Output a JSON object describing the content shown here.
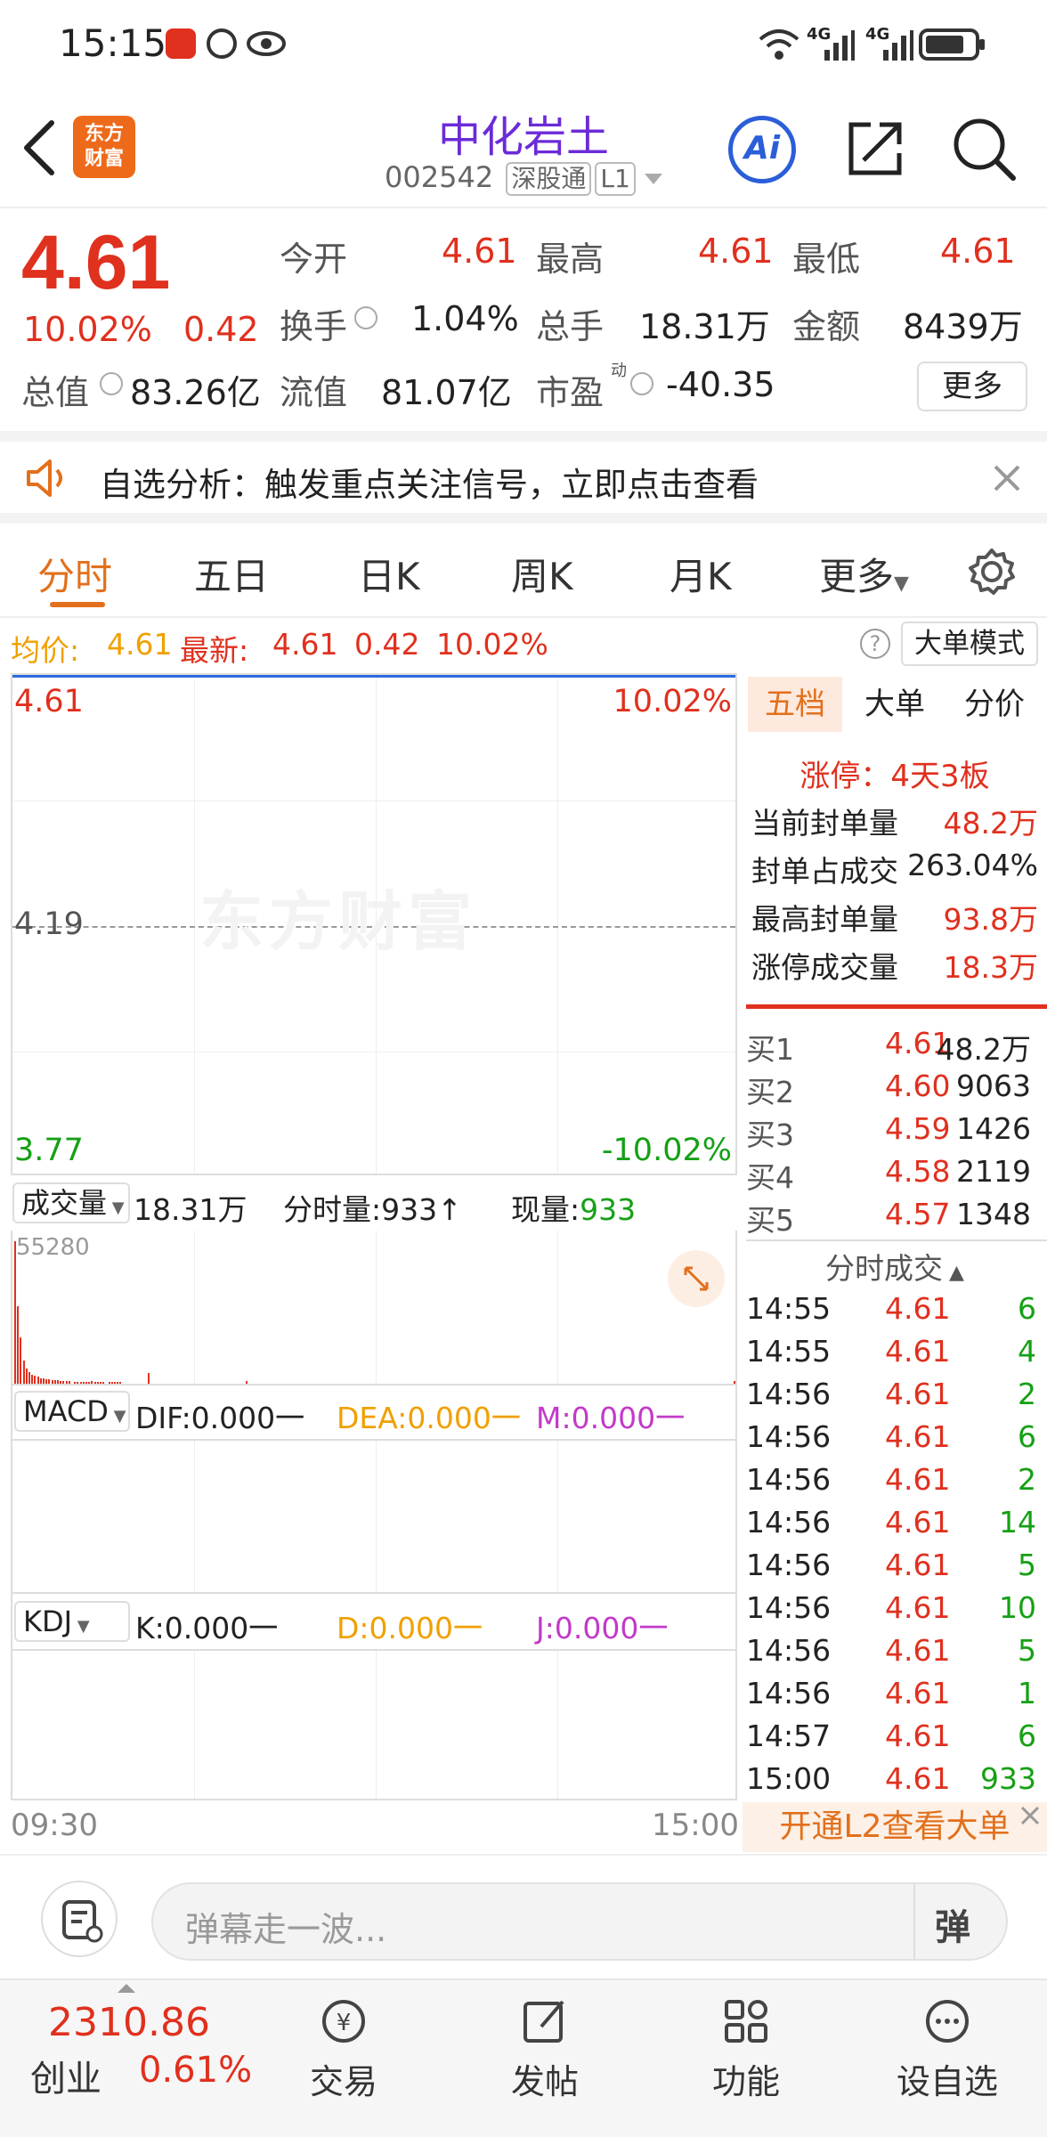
{
  "status_bar": {
    "time": "15:15",
    "signal1": "4G",
    "signal2": "4G"
  },
  "header": {
    "brand_line1": "东方",
    "brand_line2": "财富",
    "stock_name": "中化岩土",
    "stock_code": "002542",
    "market_tag": "深股通",
    "level_tag": "L1",
    "ai_label": "Ai"
  },
  "quote": {
    "price": "4.61",
    "change_pct": "10.02%",
    "change": "0.42",
    "open_label": "今开",
    "open": "4.61",
    "high_label": "最高",
    "high": "4.61",
    "low_label": "最低",
    "low": "4.61",
    "turnover_label": "换手",
    "turnover": "1.04%",
    "volume_label": "总手",
    "volume": "18.31万",
    "amount_label": "金额",
    "amount": "8439万",
    "mcap_label": "总值",
    "mcap": "83.26亿",
    "float_label": "流值",
    "float_cap": "81.07亿",
    "pe_label": "市盈",
    "pe_sup": "动",
    "pe": "-40.35",
    "more_button": "更多"
  },
  "alert": {
    "text": "自选分析：触发重点关注信号，立即点击查看"
  },
  "tabs": [
    "分时",
    "五日",
    "日K",
    "周K",
    "月K",
    "更多"
  ],
  "info_line": {
    "avg_label": "均价:",
    "avg": "4.61",
    "latest_label": "最新:",
    "latest": "4.61",
    "change": "0.42",
    "change_pct": "10.02%",
    "mode_button": "大单模式"
  },
  "chart_data": {
    "type": "line",
    "title": "",
    "y_top": "4.61",
    "y_mid": "4.19",
    "y_bottom": "3.77",
    "pct_top": "10.02%",
    "pct_bottom": "-10.02%",
    "watermark": "东方财富",
    "x_start": "09:30",
    "x_end": "15:00",
    "price_line": [
      4.61,
      4.61
    ],
    "volume_peak_label": "55280",
    "volume_bars": [
      55280,
      30000,
      18000,
      9000,
      6000,
      4500,
      3500,
      3000,
      2600,
      2200,
      2000,
      1800,
      1600,
      1500,
      1400,
      1300,
      1200,
      1100,
      1000,
      900,
      4000,
      800,
      700,
      600,
      600,
      500,
      500,
      900,
      500,
      400,
      400,
      400,
      1200,
      400,
      300,
      300,
      300,
      300,
      933
    ]
  },
  "volume_panel": {
    "selector": "成交量",
    "total": "18.31万",
    "minute_label": "分时量:",
    "minute_value": "933↑",
    "current_label": "现量:",
    "current_value": "933"
  },
  "macd_panel": {
    "selector": "MACD",
    "dif": "DIF:0.000一",
    "dea": "DEA:0.000一",
    "m": "M:0.000一"
  },
  "kdj_panel": {
    "selector": "KDJ",
    "k": "K:0.000一",
    "d": "D:0.000一",
    "j": "J:0.000一"
  },
  "right_panel": {
    "tabs": [
      "五档",
      "大单",
      "分价"
    ],
    "limit_label": "涨停：4天3板",
    "stats": [
      {
        "label": "当前封单量",
        "value": "48.2万"
      },
      {
        "label": "封单占成交",
        "value": "263.04%"
      },
      {
        "label": "最高封单量",
        "value": "93.8万"
      },
      {
        "label": "涨停成交量",
        "value": "18.3万"
      }
    ],
    "bids": [
      {
        "label": "买1",
        "price": "4.61",
        "volume": "48.2万"
      },
      {
        "label": "买2",
        "price": "4.60",
        "volume": "9063"
      },
      {
        "label": "买3",
        "price": "4.59",
        "volume": "1426"
      },
      {
        "label": "买4",
        "price": "4.58",
        "volume": "2119"
      },
      {
        "label": "买5",
        "price": "4.57",
        "volume": "1348"
      }
    ],
    "ticks_title": "分时成交",
    "ticks": [
      {
        "time": "14:55",
        "price": "4.61",
        "vol": "6"
      },
      {
        "time": "14:55",
        "price": "4.61",
        "vol": "4"
      },
      {
        "time": "14:56",
        "price": "4.61",
        "vol": "2"
      },
      {
        "time": "14:56",
        "price": "4.61",
        "vol": "6"
      },
      {
        "time": "14:56",
        "price": "4.61",
        "vol": "2"
      },
      {
        "time": "14:56",
        "price": "4.61",
        "vol": "14"
      },
      {
        "time": "14:56",
        "price": "4.61",
        "vol": "5"
      },
      {
        "time": "14:56",
        "price": "4.61",
        "vol": "10"
      },
      {
        "time": "14:56",
        "price": "4.61",
        "vol": "5"
      },
      {
        "time": "14:56",
        "price": "4.61",
        "vol": "1"
      },
      {
        "time": "14:57",
        "price": "4.61",
        "vol": "6"
      },
      {
        "time": "15:00",
        "price": "4.61",
        "vol": "933"
      }
    ],
    "l2_promo": "开通L2查看大单"
  },
  "danmaku": {
    "placeholder": "弹幕走一波...",
    "button": "弹"
  },
  "bottom_nav": {
    "index_value": "2310.86",
    "index_name": "创业",
    "index_pct": "0.61%",
    "items": [
      "交易",
      "发帖",
      "功能",
      "设自选"
    ]
  },
  "colors": {
    "up": "#e0301e",
    "down": "#15a015",
    "accent": "#e2701c",
    "avg": "#f0a000",
    "title": "#6b2bd8"
  }
}
